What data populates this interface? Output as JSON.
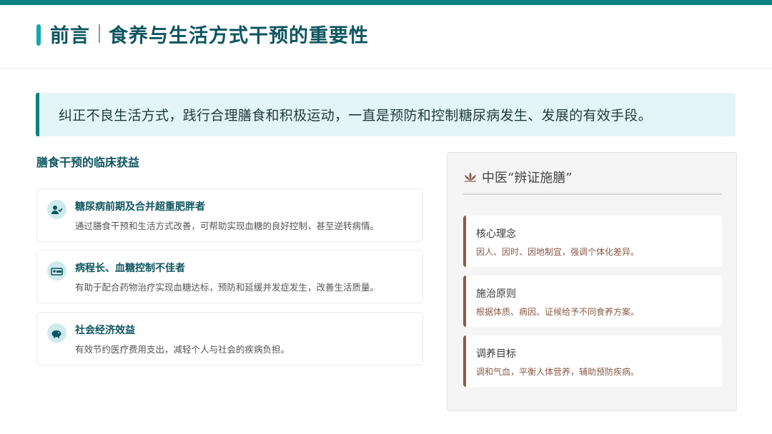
{
  "header": {
    "label": "前言",
    "title": "食养与生活方式干预的重要性"
  },
  "banner": {
    "text": "纠正不良生活方式，践行合理膳食和积极运动，一直是预防和控制糖尿病发生、发展的有效手段。"
  },
  "benefits": {
    "section_title": "膳食干预的临床获益",
    "cards": [
      {
        "icon": "user-check-icon",
        "title": "糖尿病前期及合并超重肥胖者",
        "desc": "通过膳食干预和生活方式改善，可帮助实现血糖的良好控制，甚至逆转病情。"
      },
      {
        "icon": "hospital-bed-icon",
        "title": "病程长、血糖控制不佳者",
        "desc": "有助于配合药物治疗实现血糖达标，预防和延缓并发症发生，改善生活质量。"
      },
      {
        "icon": "piggy-bank-icon",
        "title": "社会经济效益",
        "desc": "有效节约医疗费用支出，减轻个人与社会的疾病负担。"
      }
    ]
  },
  "tcm_panel": {
    "icon": "lotus-icon",
    "title": "中医“辨证施膳”",
    "items": [
      {
        "title": "核心理念",
        "desc": "因人、因时、因地制宜，强调个体化差异。"
      },
      {
        "title": "施治原则",
        "desc": "根据体质、病因、证候给予不同食养方案。"
      },
      {
        "title": "调养目标",
        "desc": "调和气血，平衡人体营养，辅助预防疾病。"
      }
    ]
  },
  "colors": {
    "accent": "#0e7f82",
    "title": "#0d5560",
    "banner_bg": "#e3f5f8",
    "brown": "#8a5a48"
  }
}
